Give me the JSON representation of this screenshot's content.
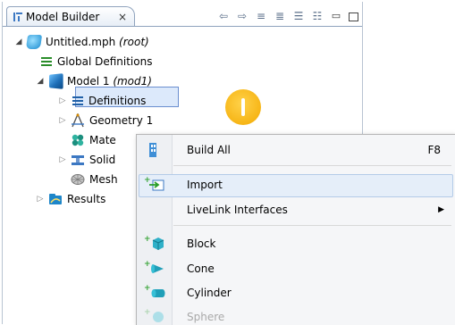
{
  "panel": {
    "title": "Model Builder",
    "close_glyph": "×",
    "toolbar": [
      {
        "name": "back-arrow-icon",
        "glyph": "⇦"
      },
      {
        "name": "forward-arrow-icon",
        "glyph": "⇨"
      },
      {
        "name": "show-options-icon",
        "glyph": "≡"
      },
      {
        "name": "filter-icon",
        "glyph": "≣"
      },
      {
        "name": "expand-all-icon",
        "glyph": "☰"
      },
      {
        "name": "collapse-all-icon",
        "glyph": "☷"
      }
    ]
  },
  "tree": {
    "root": {
      "label": "Untitled.mph",
      "tag": "(root)"
    },
    "global_definitions": "Global Definitions",
    "model": {
      "label": "Model 1",
      "tag": "(mod1)"
    },
    "definitions": "Definitions",
    "geometry": "Geometry 1",
    "materials": "Mate",
    "solid": "Solid",
    "mesh": "Mesh",
    "results": "Results"
  },
  "context_menu": {
    "items": [
      {
        "label": "Build All",
        "shortcut": "F8"
      },
      {
        "label": "Import"
      },
      {
        "label": "LiveLink Interfaces",
        "submenu_arrow": "▶"
      },
      {
        "label": "Block"
      },
      {
        "label": "Cone"
      },
      {
        "label": "Cylinder"
      },
      {
        "label": "Sphere"
      }
    ]
  },
  "colors": {
    "selection_bg": "#dce9fb",
    "hint_accent": "#f3a900",
    "menu_highlight": "#e5eef9"
  }
}
